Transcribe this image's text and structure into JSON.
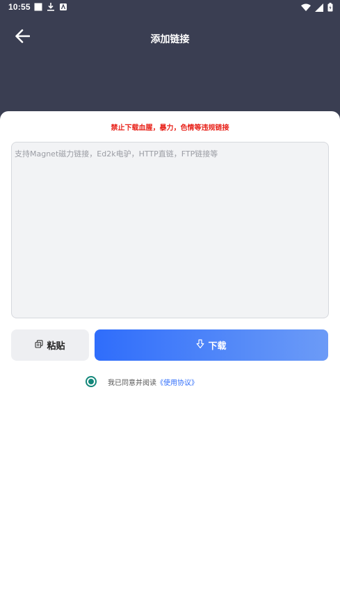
{
  "status_bar": {
    "time": "10:55",
    "left_icons": [
      "square-icon",
      "download-icon",
      "app-icon"
    ],
    "right_icons": [
      "wifi-icon",
      "signal-icon",
      "battery-icon"
    ]
  },
  "header": {
    "title": "添加链接",
    "back_icon": "arrow-left-icon",
    "background_color": "#3a3e52"
  },
  "warning": {
    "text": "禁止下载血腥，暴力，色情等违规链接",
    "color": "#e8231b"
  },
  "link_input": {
    "placeholder": "支持Magnet磁力链接，Ed2k电驴，HTTP直链，FTP链接等",
    "value": ""
  },
  "actions": {
    "paste_label": "粘贴",
    "paste_icon": "copy-icon",
    "download_label": "下载",
    "download_icon": "download-arrow-icon",
    "accent_color": "#2f6dfb"
  },
  "agreement": {
    "checked": true,
    "text": "我已同意并阅读",
    "link_text": "《使用协议》",
    "radio_color": "#13877a"
  }
}
